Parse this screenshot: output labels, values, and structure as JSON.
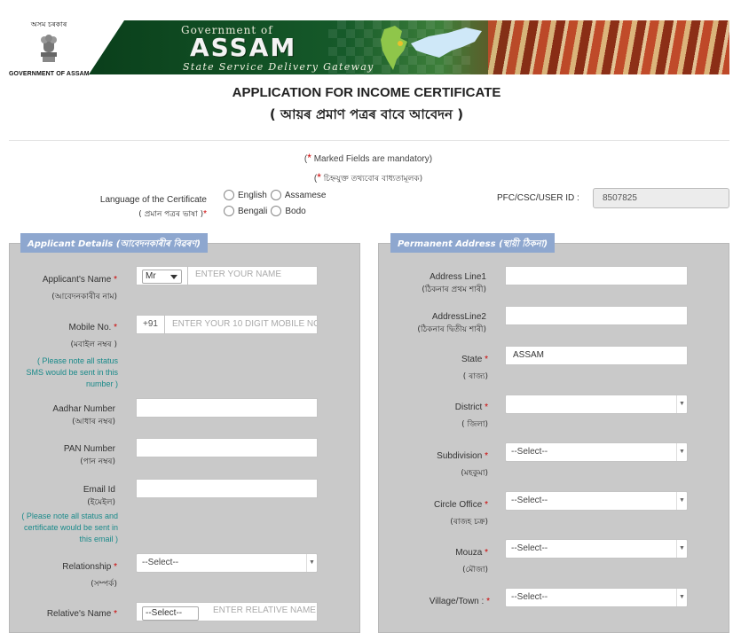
{
  "header": {
    "emblem_script": "অসম চৰকাৰ",
    "emblem_caption": "GOVERNMENT OF ASSAM",
    "banner_line1": "Government of",
    "banner_line2": "ASSAM",
    "banner_line3": "State Service Delivery Gateway"
  },
  "title": "APPLICATION FOR INCOME CERTIFICATE",
  "subtitle": "( আয়ৰ প্ৰমাণ পত্ৰৰ বাবে আবেদন )",
  "mandatory_en": "Marked Fields are mandatory)",
  "mandatory_bn": "চিহ্নযুক্ত তথ্যবোৰ বাধ্যতামূলক)",
  "language": {
    "label_en": "Language of the Certificate",
    "label_bn": "( প্ৰমান পত্ৰৰ ভাষা )",
    "options": [
      "English",
      "Assamese",
      "Bengali",
      "Bodo"
    ]
  },
  "pfc": {
    "label": "PFC/CSC/USER ID :",
    "value": "8507825"
  },
  "applicant": {
    "heading": "Applicant Details (আবেদনকাৰীৰ বিৱৰণ)",
    "name_label": "Applicant's Name",
    "name_label_bn": "(আবেদনকাৰীৰ নাম)",
    "title_select": "Mr",
    "name_placeholder": "ENTER YOUR NAME",
    "mobile_label": "Mobile No.",
    "mobile_label_bn": "(মবাইল নম্বৰ )",
    "mobile_prefix": "+91",
    "mobile_placeholder": "ENTER YOUR 10 DIGIT MOBILE NO",
    "mobile_note": "( Please note all status SMS would be sent in this number )",
    "aadhar_label": "Aadhar Number",
    "aadhar_label_bn": "(আধাৰ নম্বৰ)",
    "pan_label": "PAN Number",
    "pan_label_bn": "(পান নম্বৰ)",
    "email_label": "Email Id",
    "email_label_bn": "(ইমেইল)",
    "email_note": "( Please note all status and certificate would be sent in this email )",
    "relationship_label": "Relationship",
    "relationship_label_bn": "(সম্পৰ্ক)",
    "relationship_select": "--Select--",
    "relative_label": "Relative's Name",
    "relative_select": "--Select--",
    "relative_placeholder": "ENTER RELATIVE NAME"
  },
  "address": {
    "heading": "Permanent Address (স্থায়ী ঠিকনা)",
    "line1_label": "Address Line1",
    "line1_label_bn": "(ঠিকনাৰ প্ৰথম শাৰী)",
    "line2_label": "AddressLine2",
    "line2_label_bn": "(ঠিকনাৰ দ্বিতীয় শাৰী)",
    "state_label": "State",
    "state_label_bn": "( ৰাজ্য)",
    "state_value": "ASSAM",
    "district_label": "District",
    "district_label_bn": "( জিলা)",
    "subdivision_label": "Subdivision",
    "subdivision_label_bn": "(মহকুমা)",
    "subdivision_select": "--Select--",
    "circle_label": "Circle Office",
    "circle_label_bn": "(ৰাজহ চক্ৰ)",
    "circle_select": "--Select--",
    "mouza_label": "Mouza",
    "mouza_label_bn": "(মৌজা)",
    "mouza_select": "--Select--",
    "village_label": "Village/Town",
    "village_select": "--Select--"
  },
  "colors": {
    "panel_bg": "#c9c9c9",
    "tag_bg": "#8ea7cf",
    "required": "#cc0000",
    "note": "#1a8a8a"
  }
}
